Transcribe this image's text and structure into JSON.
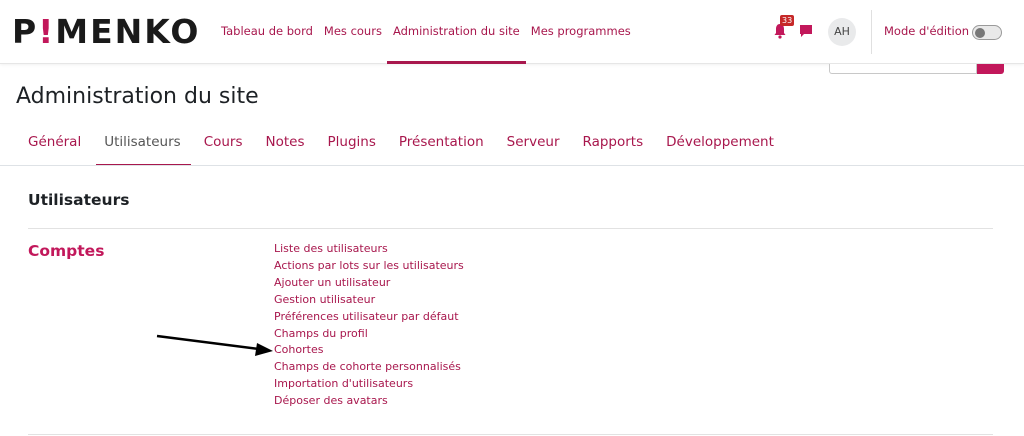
{
  "brand": {
    "logo_part1": "P",
    "logo_excl": "!",
    "logo_part2": "MENKO"
  },
  "nav": {
    "links": [
      {
        "label": "Tableau de bord",
        "active": false
      },
      {
        "label": "Mes cours",
        "active": false
      },
      {
        "label": "Administration du site",
        "active": true
      },
      {
        "label": "Mes programmes",
        "active": false
      }
    ],
    "notification_count": "33",
    "avatar_initials": "AH",
    "edit_mode_label": "Mode d'édition"
  },
  "page": {
    "title": "Administration du site"
  },
  "tabs": [
    {
      "label": "Général",
      "active": false
    },
    {
      "label": "Utilisateurs",
      "active": true
    },
    {
      "label": "Cours",
      "active": false
    },
    {
      "label": "Notes",
      "active": false
    },
    {
      "label": "Plugins",
      "active": false
    },
    {
      "label": "Présentation",
      "active": false
    },
    {
      "label": "Serveur",
      "active": false
    },
    {
      "label": "Rapports",
      "active": false
    },
    {
      "label": "Développement",
      "active": false
    }
  ],
  "section": {
    "title": "Utilisateurs",
    "category": "Comptes",
    "links": [
      "Liste des utilisateurs",
      "Actions par lots sur les utilisateurs",
      "Ajouter un utilisateur",
      "Gestion utilisateur",
      "Préférences utilisateur par défaut",
      "Champs du profil",
      "Cohortes",
      "Champs de cohorte personnalisés",
      "Importation d'utilisateurs",
      "Déposer des avatars"
    ]
  },
  "colors": {
    "accent": "#a8174d",
    "brand": "#c2185b",
    "badge": "#c62828"
  },
  "icons": [
    "bell-icon",
    "chat-icon",
    "search-icon",
    "arrow-annotation"
  ]
}
